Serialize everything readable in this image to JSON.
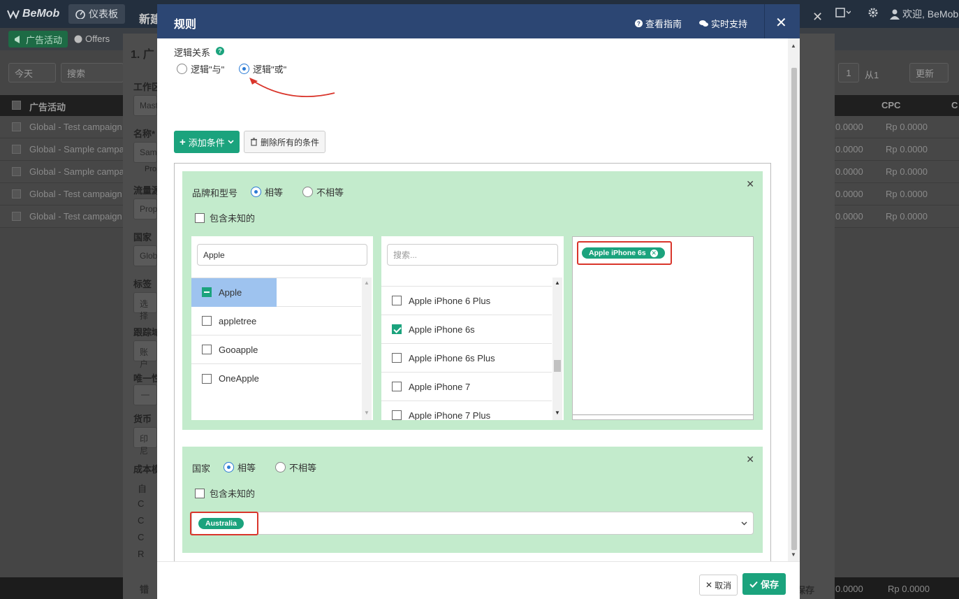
{
  "app": {
    "logo": "BeMob",
    "dashboard": "仪表板",
    "welcome": "欢迎, BeMob",
    "tabs": {
      "campaigns": "广告活动",
      "offers": "Offers"
    },
    "filters": {
      "today": "今天",
      "search": "搜索",
      "page": "1",
      "of": "从1",
      "refresh": "更新"
    },
    "table": {
      "headers": {
        "campaign": "广告活动",
        "cpc": "CPC",
        "extra": "C"
      },
      "rows": [
        {
          "name": "Global - Test campaign",
          "val": "0.0000",
          "cpc": "Rp 0.0000"
        },
        {
          "name": "Global - Sample campa",
          "val": "0.0000",
          "cpc": "Rp 0.0000"
        },
        {
          "name": "Global - Sample campa",
          "val": "0.0000",
          "cpc": "Rp 0.0000"
        },
        {
          "name": "Global - Test campaign",
          "val": "0.0000",
          "cpc": "Rp 0.0000"
        },
        {
          "name": "Global - Test campaign",
          "val": "0.0000",
          "cpc": "Rp 0.0000"
        }
      ],
      "footer": {
        "val": "0.0000",
        "cpc": "Rp 0.0000",
        "save": "保存"
      }
    }
  },
  "bgform": {
    "title": "新建",
    "section": "1. 广",
    "labels": [
      "工作区",
      "名称*",
      "流量源",
      "国家",
      "标签",
      "跟踪域",
      "唯一性",
      "货币",
      "成本模"
    ],
    "values": [
      "Mast",
      "Samp",
      "Prop",
      "Glob",
      "选择",
      "账户",
      "",
      "印尼"
    ],
    "sublabel": "Prop",
    "stepper_minus": "—",
    "cost_models": [
      "自",
      "C",
      "C",
      "C",
      "R"
    ],
    "status": "错"
  },
  "modal": {
    "title": "规则",
    "guide": "查看指南",
    "support": "实时支持",
    "logic_label": "逻辑关系",
    "logic_and": "逻辑\"与\"",
    "logic_or": "逻辑\"或\"",
    "add_condition": "添加条件",
    "delete_all": "删除所有的条件",
    "cancel": "取消",
    "save": "保存",
    "device_rule": {
      "label": "品牌和型号",
      "equal": "相等",
      "not_equal": "不相等",
      "include_unknown": "包含未知的",
      "brand_search": "Apple",
      "brands": [
        {
          "name": "Apple",
          "state": "partial"
        },
        {
          "name": "appletree",
          "state": "unchecked"
        },
        {
          "name": "Gooapple",
          "state": "unchecked"
        },
        {
          "name": "OneApple",
          "state": "unchecked"
        }
      ],
      "model_search_placeholder": "搜索...",
      "models": [
        {
          "name": "Apple iPhone 6 Plus",
          "checked": false
        },
        {
          "name": "Apple iPhone 6s",
          "checked": true
        },
        {
          "name": "Apple iPhone 6s Plus",
          "checked": false
        },
        {
          "name": "Apple iPhone 7",
          "checked": false
        },
        {
          "name": "Apple iPhone 7 Plus",
          "checked": false
        }
      ],
      "selected": [
        "Apple iPhone 6s"
      ]
    },
    "country_rule": {
      "label": "国家",
      "equal": "相等",
      "not_equal": "不相等",
      "include_unknown": "包含未知的",
      "selected": [
        "Australia"
      ]
    }
  }
}
